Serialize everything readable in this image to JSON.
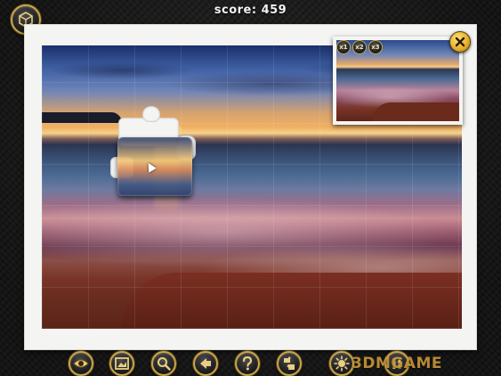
{
  "hud": {
    "score_label": "score: 459"
  },
  "preview": {
    "zoom_buttons": [
      "x1",
      "x2",
      "x3"
    ]
  },
  "toolbar": {
    "buttons": [
      {
        "icon": "eye-icon"
      },
      {
        "icon": "picture-frame-icon"
      },
      {
        "icon": "magnifier-icon"
      },
      {
        "icon": "arrow-icon"
      },
      {
        "icon": "help-icon"
      },
      {
        "icon": "puzzle-pieces-icon"
      },
      {
        "icon": "sun-icon"
      },
      {
        "icon": "pause-icon"
      }
    ]
  },
  "watermark": "3DMGAME",
  "colors": {
    "accent_gold": "#c9a64b",
    "close_yellow": "#e6b230",
    "board_white": "#f4f4f2"
  }
}
